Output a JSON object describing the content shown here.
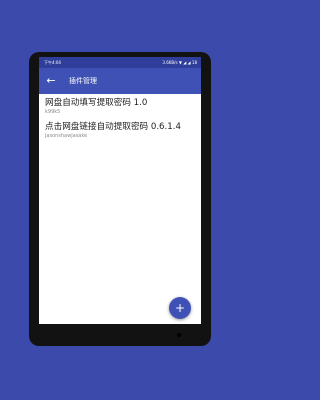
{
  "status_bar": {
    "left": "下午4:04",
    "right": "3.6KB/s ▼ ◢ ◢ 18"
  },
  "app_bar": {
    "back_icon": "←",
    "title": "插件管理"
  },
  "plugins": [
    {
      "name": "网盘自动填写提取密码 1.0",
      "author": "k99k5"
    },
    {
      "name": "点击网盘链接自动提取密码 0.6.1.4",
      "author": "jasonshawjasake"
    }
  ],
  "fab": {
    "icon": "+"
  },
  "colors": {
    "background": "#3b4aab",
    "primary": "#3f51b5",
    "status_bar": "#2f3e9b",
    "device_frame": "#121212"
  }
}
